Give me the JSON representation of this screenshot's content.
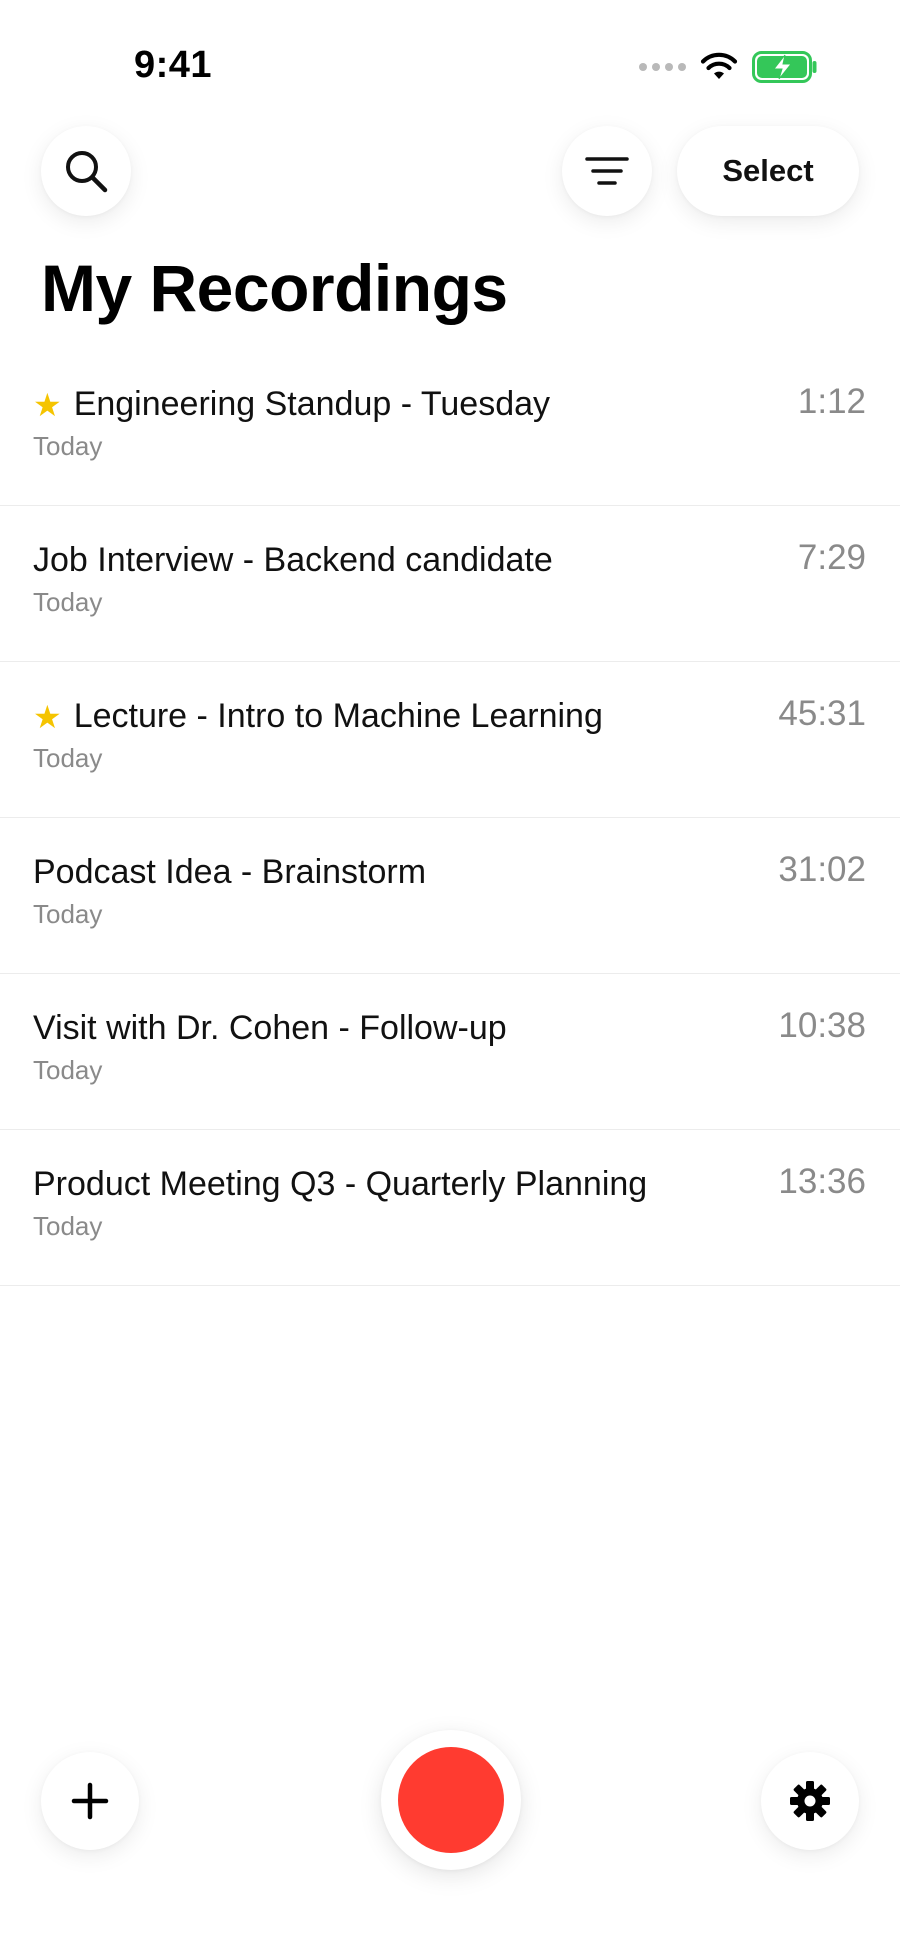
{
  "status_bar": {
    "time": "9:41",
    "icons": [
      "signal-dots-icon",
      "wifi-icon",
      "battery-charging-icon"
    ],
    "battery_color": "#34c759"
  },
  "toolbar": {
    "search_icon": "search-icon",
    "filter_icon": "filter-icon",
    "select_label": "Select"
  },
  "page": {
    "title": "My Recordings"
  },
  "recordings": [
    {
      "title": "Engineering Standup - Tuesday",
      "date": "Today",
      "duration": "1:12",
      "starred": true
    },
    {
      "title": "Job Interview - Backend candidate",
      "date": "Today",
      "duration": "7:29",
      "starred": false
    },
    {
      "title": "Lecture - Intro to Machine Learning",
      "date": "Today",
      "duration": "45:31",
      "starred": true
    },
    {
      "title": "Podcast Idea - Brainstorm",
      "date": "Today",
      "duration": "31:02",
      "starred": false
    },
    {
      "title": "Visit with Dr. Cohen - Follow-up",
      "date": "Today",
      "duration": "10:38",
      "starred": false
    },
    {
      "title": "Product Meeting Q3 - Quarterly Planning",
      "date": "Today",
      "duration": "13:36",
      "starred": false
    }
  ],
  "bottom_bar": {
    "add_icon": "plus-icon",
    "record_icon": "record-icon",
    "settings_icon": "gear-icon"
  },
  "colors": {
    "record": "#ff3b30",
    "star": "#f5c400",
    "secondary_text": "#8a8a8a"
  }
}
